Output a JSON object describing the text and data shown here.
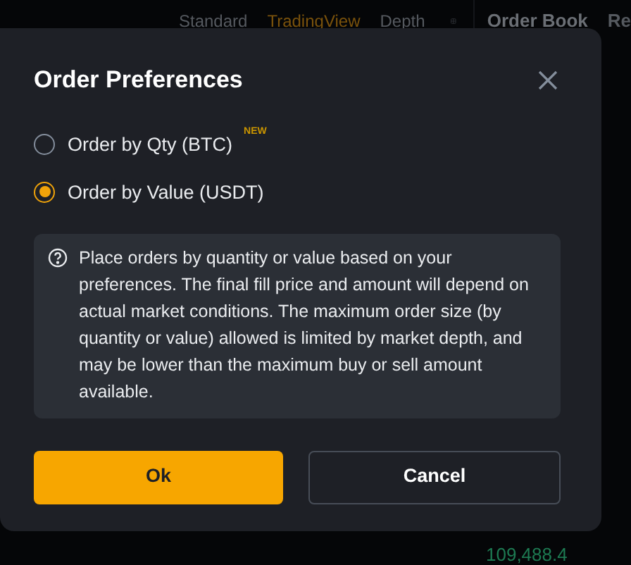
{
  "background": {
    "chart_tabs": [
      {
        "label": "Standard",
        "selected": false
      },
      {
        "label": "TradingView",
        "selected": true
      },
      {
        "label": "Depth",
        "selected": false
      }
    ],
    "panel_tabs": [
      {
        "label": "Order Book"
      },
      {
        "label": "Re"
      }
    ],
    "price": "109,488.4"
  },
  "dialog": {
    "title": "Order Preferences",
    "options": [
      {
        "label": "Order by Qty (BTC)",
        "badge": "NEW",
        "selected": false
      },
      {
        "label": "Order by Value (USDT)",
        "selected": true
      }
    ],
    "info": "Place orders by quantity or value based on your preferences. The final fill price and amount will depend on actual market conditions. The maximum order size (by quantity or value) allowed is limited by market depth, and may be lower than the maximum buy or sell amount available.",
    "buttons": [
      {
        "label": "Ok",
        "kind": "primary"
      },
      {
        "label": "Cancel",
        "kind": "secondary"
      }
    ]
  }
}
